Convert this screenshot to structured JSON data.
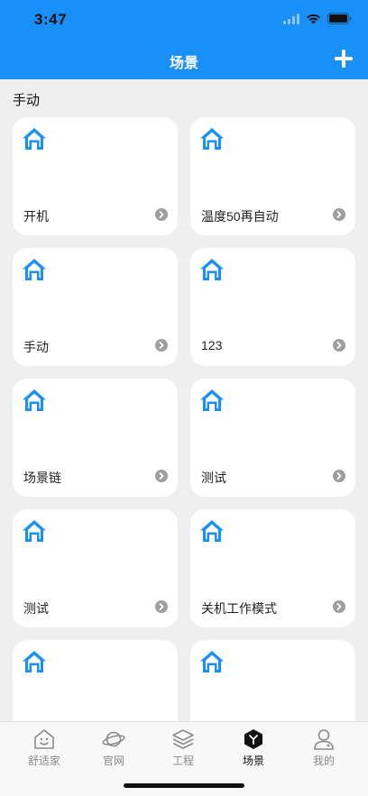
{
  "status_bar": {
    "time": "3:47"
  },
  "nav": {
    "title": "场景",
    "add_icon": "plus-icon"
  },
  "section": {
    "title": "手动"
  },
  "colors": {
    "brand": "#1890f7",
    "home_icon": "#1890f7",
    "arrow": "#9e9e9e"
  },
  "cards": [
    {
      "label": "开机"
    },
    {
      "label": "温度50再自动"
    },
    {
      "label": "手动"
    },
    {
      "label": "123"
    },
    {
      "label": "场景链"
    },
    {
      "label": "测试"
    },
    {
      "label": "测试"
    },
    {
      "label": "关机工作模式"
    },
    {
      "label": ""
    },
    {
      "label": ""
    }
  ],
  "tabbar": {
    "tabs": [
      {
        "label": "舒适家",
        "icon": "smile-house-icon"
      },
      {
        "label": "官网",
        "icon": "planet-icon"
      },
      {
        "label": "工程",
        "icon": "layers-icon"
      },
      {
        "label": "场景",
        "icon": "scene-cube-icon",
        "active": true
      },
      {
        "label": "我的",
        "icon": "user-icon"
      }
    ]
  }
}
